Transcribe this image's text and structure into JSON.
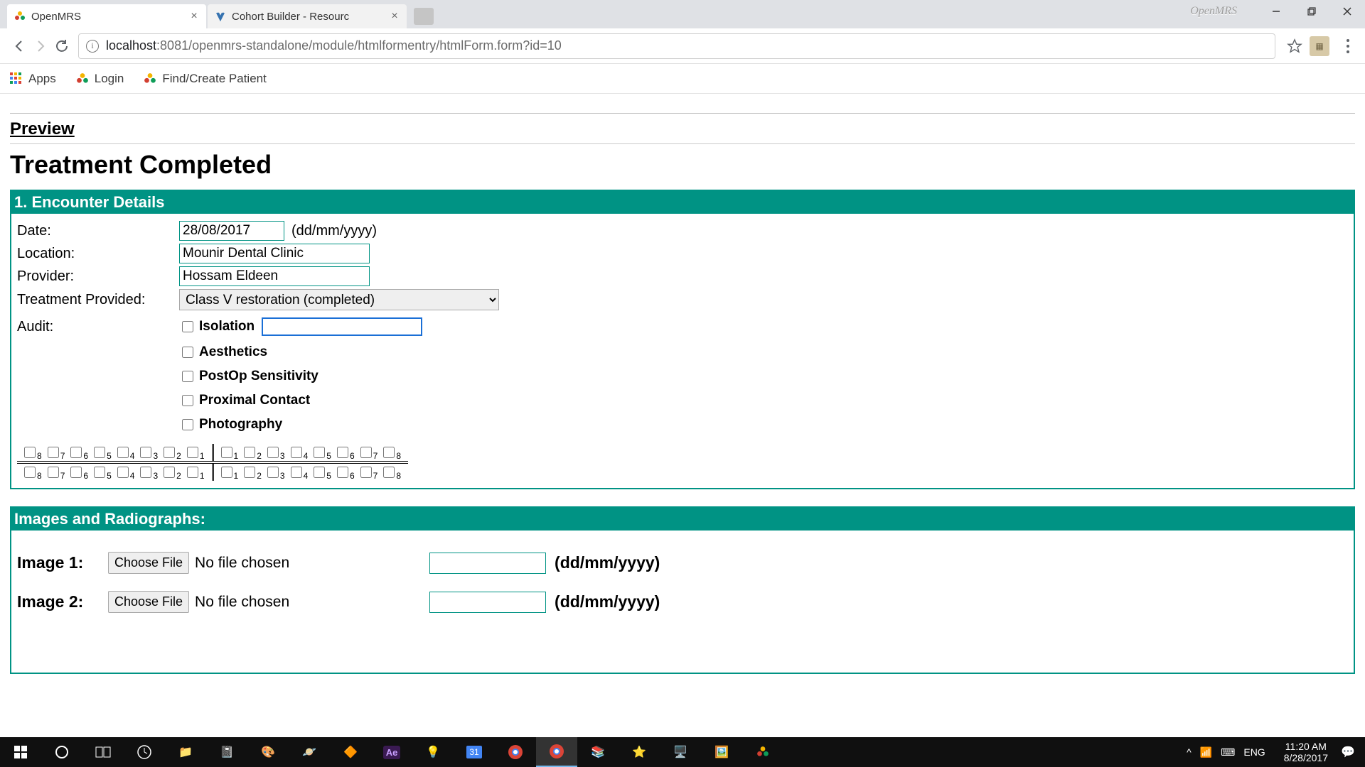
{
  "window": {
    "badge": "OpenMRS",
    "tabs": [
      {
        "title": "OpenMRS",
        "active": true
      },
      {
        "title": "Cohort Builder - Resourc",
        "active": false
      }
    ],
    "controls": {
      "min": "–",
      "max": "❐",
      "close": "✕"
    }
  },
  "address": {
    "host": "localhost",
    "port_path": ":8081/openmrs-standalone/module/htmlformentry/htmlForm.form?id=10"
  },
  "bookmarks": [
    {
      "label": "Apps"
    },
    {
      "label": "Login"
    },
    {
      "label": "Find/Create Patient"
    }
  ],
  "page": {
    "preview_label": "Preview",
    "title": "Treatment Completed",
    "section1": {
      "header": "1. Encounter Details",
      "date_label": "Date:",
      "date_value": "28/08/2017",
      "date_hint": "(dd/mm/yyyy)",
      "location_label": "Location:",
      "location_value": "Mounir Dental Clinic",
      "provider_label": "Provider:",
      "provider_value": "Hossam Eldeen",
      "treatment_label": "Treatment Provided:",
      "treatment_value": "Class V restoration (completed)",
      "audit_label": "Audit:",
      "audit_items": [
        "Isolation",
        "Aesthetics",
        "PostOp Sensitivity",
        "Proximal Contact",
        "Photography"
      ],
      "tooth_numbers_desc": [
        "8",
        "7",
        "6",
        "5",
        "4",
        "3",
        "2",
        "1"
      ],
      "tooth_numbers_asc": [
        "1",
        "2",
        "3",
        "4",
        "5",
        "6",
        "7",
        "8"
      ]
    },
    "section2": {
      "header": "Images and Radiographs:",
      "rows": [
        {
          "label": "Image 1:",
          "button": "Choose File",
          "status": "No file chosen",
          "date": "",
          "hint": "(dd/mm/yyyy)"
        },
        {
          "label": "Image 2:",
          "button": "Choose File",
          "status": "No file chosen",
          "date": "",
          "hint": "(dd/mm/yyyy)"
        }
      ]
    }
  },
  "taskbar": {
    "lang": "ENG",
    "time": "11:20 AM",
    "date": "8/28/2017"
  }
}
